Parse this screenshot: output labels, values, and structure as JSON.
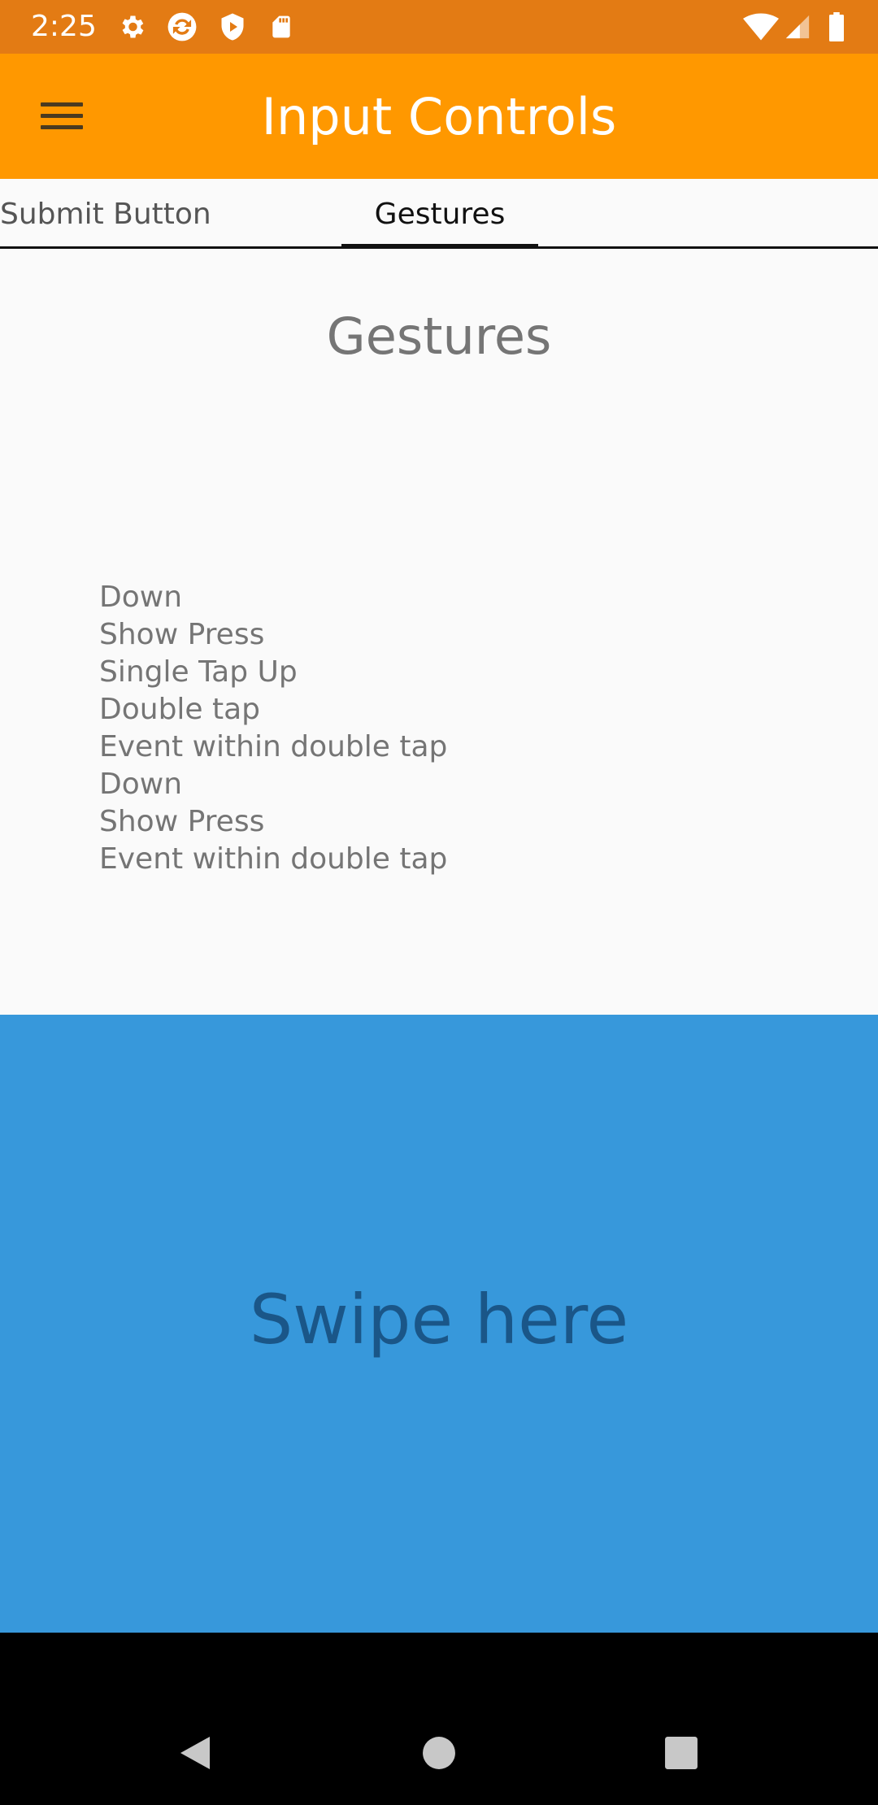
{
  "status_bar": {
    "time": "2:25",
    "left_icons": [
      "gear-icon",
      "sync-icon",
      "shield-play-icon",
      "sd-card-icon"
    ],
    "right_icons": [
      "wifi-icon",
      "cell-signal-icon",
      "battery-icon"
    ]
  },
  "app_bar": {
    "title": "Input Controls",
    "menu_icon": "menu-icon"
  },
  "tabs": [
    {
      "label": "Submit Button",
      "selected": false
    },
    {
      "label": "Gestures",
      "selected": true
    }
  ],
  "content": {
    "title": "Gestures",
    "events": [
      "Down",
      "Show Press",
      "Single Tap Up",
      "Double tap",
      "Event within double tap",
      "Down",
      "Show Press",
      "Event within double tap"
    ]
  },
  "swipe_area": {
    "label": "Swipe here"
  },
  "colors": {
    "status_bar": "#e37b14",
    "app_bar": "#ff9800",
    "swipe_area": "#3798db",
    "swipe_text": "#1a5688"
  },
  "nav_bar": {
    "buttons": [
      "back-icon",
      "home-icon",
      "recents-icon"
    ]
  }
}
